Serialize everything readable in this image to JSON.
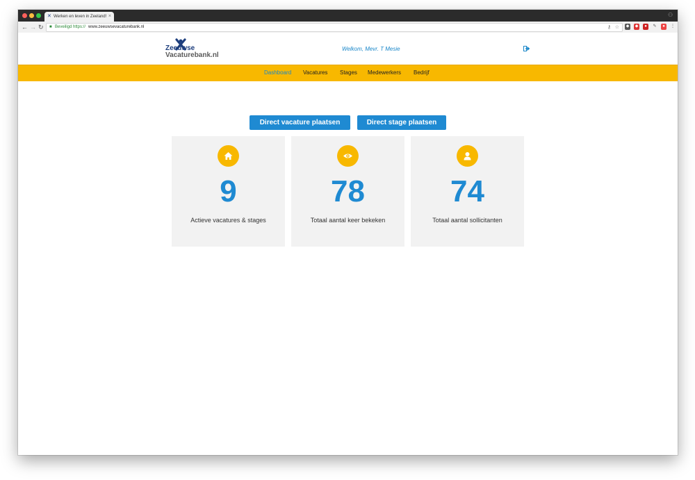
{
  "browser": {
    "tab_title": "Werken en leven in Zeeland!",
    "tab_close": "×",
    "secure_label": "Beveiligd",
    "url_scheme": "https://",
    "url_host": "www.zeeuwsevacaturebank.nl"
  },
  "header": {
    "logo_line1": "Zeeuwse",
    "logo_line2": "Vacaturebank.nl",
    "welcome": "Welkom, Mevr. T Mesie"
  },
  "nav": {
    "items": [
      "Dashboard",
      "Vacatures",
      "Stages",
      "Medewerkers",
      "Bedrijf"
    ],
    "active": "Dashboard"
  },
  "actions": {
    "primary": "Direct vacature plaatsen",
    "secondary": "Direct stage plaatsen"
  },
  "stats": [
    {
      "icon": "home-icon",
      "value": "9",
      "label": "Actieve vacatures & stages"
    },
    {
      "icon": "eye-icon",
      "value": "78",
      "label": "Totaal aantal keer bekeken"
    },
    {
      "icon": "user-icon",
      "value": "74",
      "label": "Totaal aantal sollicitanten"
    }
  ],
  "colors": {
    "accent_yellow": "#f8b800",
    "accent_blue": "#1f8ad2",
    "card_bg": "#f2f2f2"
  }
}
